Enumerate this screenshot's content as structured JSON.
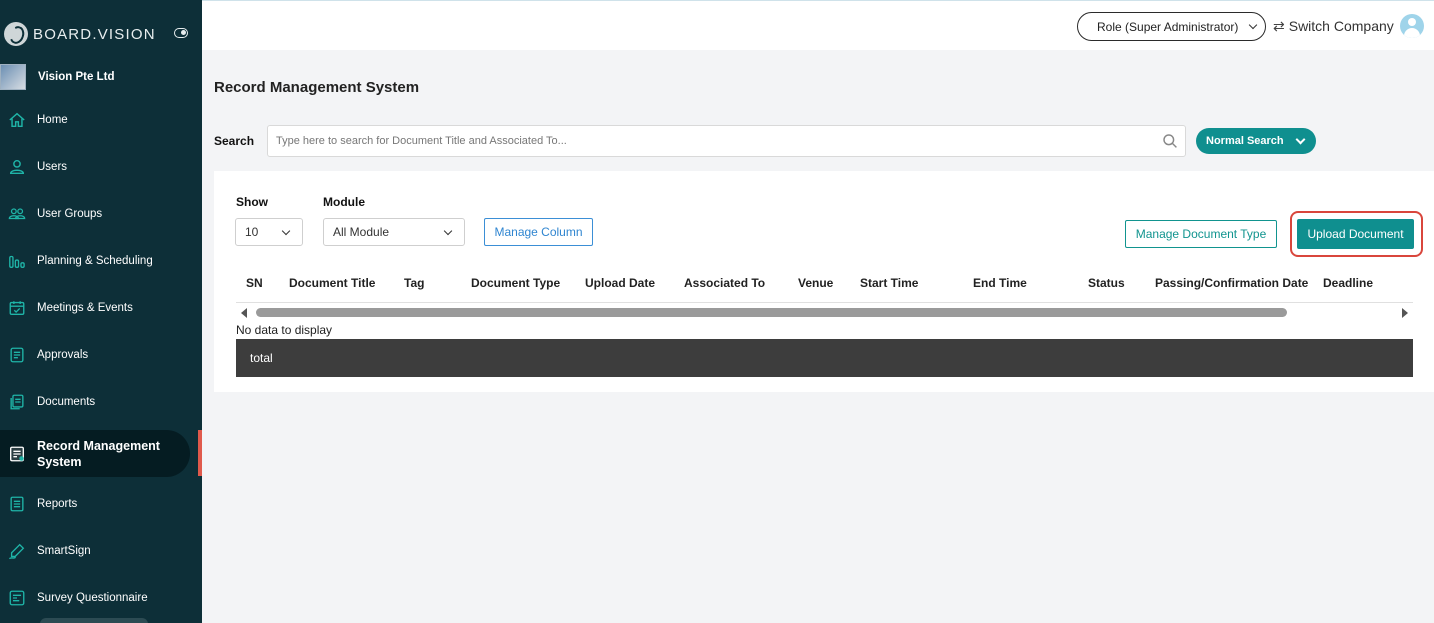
{
  "brand": {
    "name": "BOARD.VISION"
  },
  "company": {
    "name": "Vision Pte Ltd"
  },
  "sidebar": {
    "items": [
      {
        "label": "Home",
        "icon": "home-icon"
      },
      {
        "label": "Users",
        "icon": "user-icon"
      },
      {
        "label": "User Groups",
        "icon": "user-group-icon"
      },
      {
        "label": "Planning & Scheduling",
        "icon": "bar-chart-icon"
      },
      {
        "label": "Meetings & Events",
        "icon": "calendar-icon"
      },
      {
        "label": "Approvals",
        "icon": "document-icon"
      },
      {
        "label": "Documents",
        "icon": "documents-icon"
      },
      {
        "label": "Record Management System",
        "icon": "record-icon",
        "active": true
      },
      {
        "label": "Reports",
        "icon": "report-icon"
      },
      {
        "label": "SmartSign",
        "icon": "pen-icon"
      },
      {
        "label": "Survey Questionnaire",
        "icon": "survey-icon"
      }
    ],
    "accent_color": "#e05a4c"
  },
  "topbar": {
    "role": "Role (Super Administrator)",
    "switch_company": "Switch Company"
  },
  "main": {
    "title": "Record Management System",
    "search": {
      "label": "Search",
      "placeholder": "Type here to search for Document Title and Associated To...",
      "mode": "Normal Search"
    },
    "controls": {
      "show_label": "Show",
      "show_value": "10",
      "module_label": "Module",
      "module_value": "All Module",
      "manage_column": "Manage Column",
      "manage_document_type": "Manage Document Type",
      "upload_document": "Upload Document"
    },
    "table": {
      "columns": [
        "SN",
        "Document Title",
        "Tag",
        "Document Type",
        "Upload Date",
        "Associated To",
        "Venue",
        "Start Time",
        "End Time",
        "Status",
        "Passing/Confirmation Date",
        "Deadline"
      ],
      "empty_text": "No data to display",
      "footer": "total"
    }
  },
  "colors": {
    "sidebar_bg": "#0d2f38",
    "primary": "#0f8f8f",
    "link": "#2f85d0",
    "highlight": "#d9463c"
  }
}
